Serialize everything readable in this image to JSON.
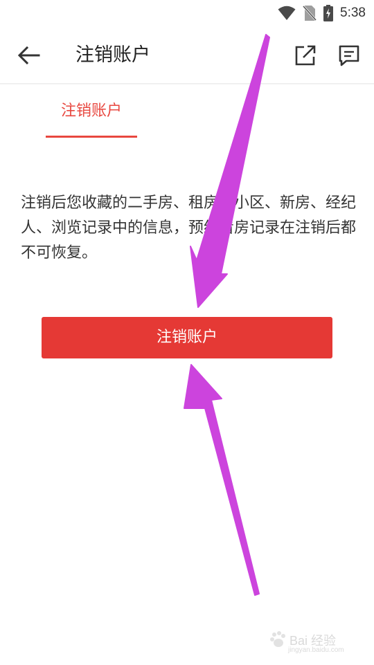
{
  "status_bar": {
    "time": "5:38",
    "icons": [
      "wifi-icon",
      "no-sim-icon",
      "battery-charging-icon"
    ]
  },
  "app_bar": {
    "title": "注销账户",
    "back_icon": "arrow-left-icon",
    "share_icon": "share-external-icon",
    "feedback_icon": "message-feedback-icon"
  },
  "tab": {
    "label": "注销账户"
  },
  "description": "注销后您收藏的二手房、租房、小区、新房、经纪人、浏览记录中的信息，预约看房记录在注销后都不可恢复。",
  "cancel_button": {
    "label": "注销账户"
  },
  "colors": {
    "accent": "#e8473f",
    "button": "#e53935",
    "annotation": "#cc44dd"
  },
  "watermark": {
    "text": "Bai 经验",
    "sub": "jingyan.baidu.com"
  }
}
